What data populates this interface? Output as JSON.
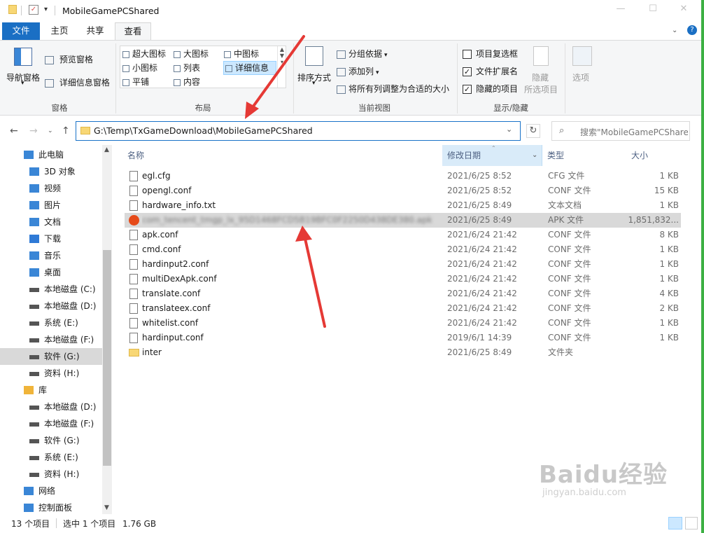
{
  "window": {
    "title": "MobileGamePCShared"
  },
  "tabs": {
    "file": "文件",
    "home": "主页",
    "share": "共享",
    "view": "查看"
  },
  "ribbon": {
    "pane": {
      "nav_pane": "导航窗格",
      "preview_pane": "预览窗格",
      "details_pane": "详细信息窗格",
      "group": "窗格"
    },
    "layout": {
      "xl_icons": "超大图标",
      "l_icons": "大图标",
      "m_icons": "中图标",
      "s_icons": "小图标",
      "list": "列表",
      "details": "详细信息",
      "tiles": "平铺",
      "content": "内容",
      "group": "布局"
    },
    "current_view": {
      "sort_by": "排序方式",
      "group_by": "分组依据",
      "add_cols": "添加列",
      "fit_cols": "将所有列调整为合适的大小",
      "group": "当前视图"
    },
    "show_hide": {
      "item_checkboxes": "项目复选框",
      "file_ext": "文件扩展名",
      "hidden_items": "隐藏的项目",
      "hide_selected": "隐藏",
      "hide_selected2": "所选项目",
      "options": "选项",
      "group": "显示/隐藏",
      "item_checkboxes_checked": false,
      "file_ext_checked": true,
      "hidden_items_checked": true
    }
  },
  "address": {
    "path": "G:\\Temp\\TxGameDownload\\MobileGamePCShared",
    "search_placeholder": "搜索\"MobileGamePCShared\""
  },
  "nav": [
    {
      "label": "此电脑",
      "icon": "computer-icon"
    },
    {
      "label": "3D 对象",
      "icon": "3d-icon"
    },
    {
      "label": "视频",
      "icon": "video-icon"
    },
    {
      "label": "图片",
      "icon": "picture-icon"
    },
    {
      "label": "文档",
      "icon": "document-icon"
    },
    {
      "label": "下载",
      "icon": "download-icon"
    },
    {
      "label": "音乐",
      "icon": "music-icon"
    },
    {
      "label": "桌面",
      "icon": "desktop-icon"
    },
    {
      "label": "本地磁盘 (C:)",
      "icon": "drive-icon"
    },
    {
      "label": "本地磁盘 (D:)",
      "icon": "drive-icon"
    },
    {
      "label": "系统 (E:)",
      "icon": "drive-icon"
    },
    {
      "label": "本地磁盘 (F:)",
      "icon": "drive-icon"
    },
    {
      "label": "软件 (G:)",
      "icon": "drive-icon"
    },
    {
      "label": "资料 (H:)",
      "icon": "drive-icon"
    },
    {
      "label": "库",
      "icon": "library-icon"
    },
    {
      "label": "本地磁盘 (D:)",
      "icon": "drive-icon"
    },
    {
      "label": "本地磁盘 (F:)",
      "icon": "drive-icon"
    },
    {
      "label": "软件 (G:)",
      "icon": "drive-icon"
    },
    {
      "label": "系统 (E:)",
      "icon": "drive-icon"
    },
    {
      "label": "资料 (H:)",
      "icon": "drive-icon"
    },
    {
      "label": "网络",
      "icon": "network-icon"
    },
    {
      "label": "控制面板",
      "icon": "control-panel-icon"
    }
  ],
  "columns": {
    "name": "名称",
    "date": "修改日期",
    "type": "类型",
    "size": "大小"
  },
  "files": [
    {
      "name": "egl.cfg",
      "date": "2021/6/25 8:52",
      "type": "CFG 文件",
      "size": "1 KB",
      "kind": "file"
    },
    {
      "name": "opengl.conf",
      "date": "2021/6/25 8:52",
      "type": "CONF 文件",
      "size": "15 KB",
      "kind": "file"
    },
    {
      "name": "hardware_info.txt",
      "date": "2021/6/25 8:49",
      "type": "文本文档",
      "size": "1 KB",
      "kind": "file"
    },
    {
      "name": "com_tencent_tmgp_lx_95D1468FCD5B19BFC0F2250D438DE380.apk",
      "date": "2021/6/25 8:49",
      "type": "APK 文件",
      "size": "1,851,832...",
      "kind": "apk"
    },
    {
      "name": "apk.conf",
      "date": "2021/6/24 21:42",
      "type": "CONF 文件",
      "size": "8 KB",
      "kind": "file"
    },
    {
      "name": "cmd.conf",
      "date": "2021/6/24 21:42",
      "type": "CONF 文件",
      "size": "1 KB",
      "kind": "file"
    },
    {
      "name": "hardinput2.conf",
      "date": "2021/6/24 21:42",
      "type": "CONF 文件",
      "size": "1 KB",
      "kind": "file"
    },
    {
      "name": "multiDexApk.conf",
      "date": "2021/6/24 21:42",
      "type": "CONF 文件",
      "size": "1 KB",
      "kind": "file"
    },
    {
      "name": "translate.conf",
      "date": "2021/6/24 21:42",
      "type": "CONF 文件",
      "size": "4 KB",
      "kind": "file"
    },
    {
      "name": "translateex.conf",
      "date": "2021/6/24 21:42",
      "type": "CONF 文件",
      "size": "2 KB",
      "kind": "file"
    },
    {
      "name": "whitelist.conf",
      "date": "2021/6/24 21:42",
      "type": "CONF 文件",
      "size": "1 KB",
      "kind": "file"
    },
    {
      "name": "hardinput.conf",
      "date": "2019/6/1 14:39",
      "type": "CONF 文件",
      "size": "1 KB",
      "kind": "file"
    },
    {
      "name": "inter",
      "date": "2021/6/25 8:49",
      "type": "文件夹",
      "size": "",
      "kind": "folder"
    }
  ],
  "status": {
    "count": "13 个项目",
    "selected": "选中 1 个项目",
    "size": "1.76 GB"
  },
  "watermark": {
    "brand": "Baidu经验",
    "url": "jingyan.baidu.com"
  },
  "colors": {
    "accent": "#1a6fc4",
    "annotation": "#e53935",
    "selection": "#d9d9d9"
  }
}
